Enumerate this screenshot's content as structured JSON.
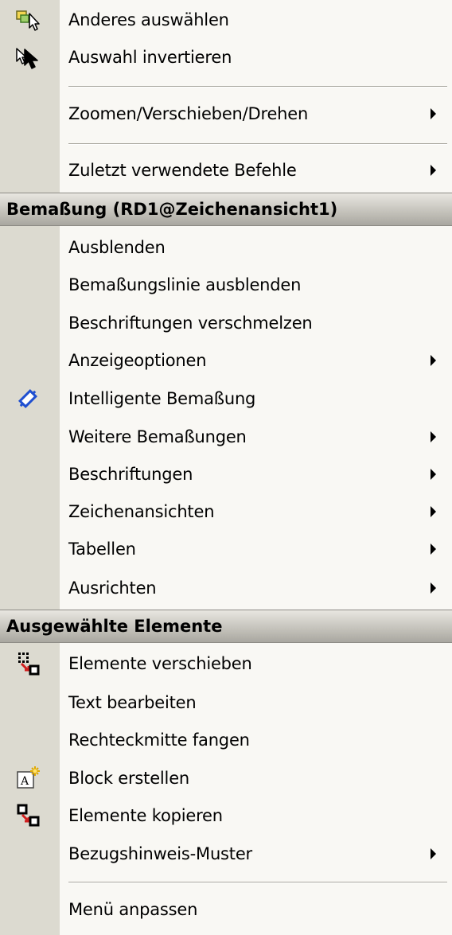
{
  "menu": {
    "group1": [
      {
        "label": "Anderes auswählen",
        "icon": "select-other-icon"
      },
      {
        "label": "Auswahl invertieren",
        "icon": "invert-selection-icon"
      },
      {
        "label": "Zoomen/Verschieben/Drehen",
        "submenu": true
      },
      {
        "label": "Zuletzt verwendete Befehle",
        "submenu": true
      }
    ],
    "section1_header": "Bemaßung (RD1@Zeichenansicht1)",
    "group2": [
      {
        "label": "Ausblenden"
      },
      {
        "label": "Bemaßungslinie ausblenden"
      },
      {
        "label": "Beschriftungen verschmelzen"
      },
      {
        "label": "Anzeigeoptionen",
        "submenu": true
      },
      {
        "label": "Intelligente Bemaßung",
        "icon": "smart-dimension-icon"
      },
      {
        "label": "Weitere Bemaßungen",
        "submenu": true
      },
      {
        "label": "Beschriftungen",
        "submenu": true
      },
      {
        "label": "Zeichenansichten",
        "submenu": true
      },
      {
        "label": "Tabellen",
        "submenu": true
      },
      {
        "label": "Ausrichten",
        "submenu": true
      }
    ],
    "section2_header": "Ausgewählte Elemente",
    "group3": [
      {
        "label": "Elemente verschieben",
        "icon": "move-entities-icon"
      },
      {
        "label": "Text bearbeiten"
      },
      {
        "label": "Rechteckmitte fangen"
      },
      {
        "label": "Block erstellen",
        "icon": "make-block-icon"
      },
      {
        "label": "Elemente kopieren",
        "icon": "copy-entities-icon"
      },
      {
        "label": "Bezugshinweis-Muster",
        "submenu": true
      },
      {
        "label": "Menü anpassen"
      }
    ]
  },
  "colors": {
    "gutter": "#dcdad0",
    "background": "#f9f8f4",
    "header_gradient_top": "#e8e6e0",
    "header_gradient_bottom": "#a9a7a0",
    "icon_blue": "#1f4fd0",
    "icon_red": "#d02020"
  }
}
